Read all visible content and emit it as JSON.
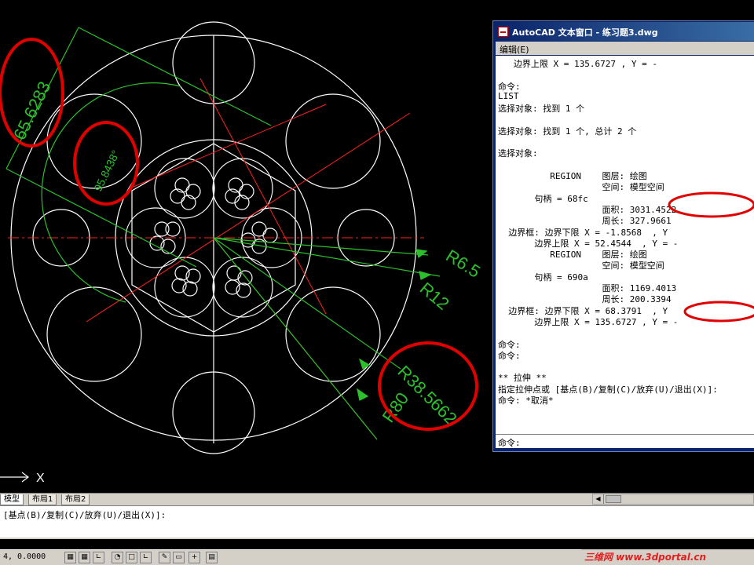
{
  "text_window": {
    "title": "AutoCAD 文本窗口 - 练习题3.dwg",
    "menu": "编辑(E)",
    "lines": [
      "   边界上限 X = 135.6727 , Y = -",
      "",
      "命令:",
      "LIST",
      "选择对象: 找到 1 个",
      "",
      "选择对象: 找到 1 个, 总计 2 个",
      "",
      "选择对象:",
      "",
      "          REGION    图层: 绘图",
      "                    空间: 模型空间",
      "       句柄 = 68fc",
      "                    面积: 3031.4522",
      "                    周长: 327.9661",
      "  边界框: 边界下限 X = -1.8568  , Y",
      "       边界上限 X = 52.4544  , Y = -",
      "          REGION    图层: 绘图",
      "                    空间: 模型空间",
      "       句柄 = 690a",
      "                    面积: 1169.4013",
      "                    周长: 200.3394",
      "  边界框: 边界下限 X = 68.3791  , Y",
      "       边界上限 X = 135.6727 , Y = -",
      "",
      "命令:",
      "命令:",
      "",
      "** 拉伸 **",
      "指定拉伸点或 [基点(B)/复制(C)/放弃(U)/退出(X)]:",
      "命令: *取消*"
    ],
    "prompt": "命令:"
  },
  "dimensions": {
    "d1": "65.6283",
    "d2": "95.8438°",
    "r1": "R6.5",
    "r2": "R12",
    "r3": "R38.5662",
    "r4": "R80"
  },
  "ucs_label": "X",
  "tabs": [
    "模型",
    "布局1",
    "布局2"
  ],
  "command_line": "[基点(B)/复制(C)/放弃(U)/退出(X)]:",
  "status": {
    "coords": "4, 0.0000"
  },
  "watermark": "三维网 www.3dportal.cn",
  "colors": {
    "background": "#000000",
    "geometry": "#ffffff",
    "dimension": "#2cc02c",
    "centerline": "#ff2020",
    "annotation": "#e00000"
  }
}
